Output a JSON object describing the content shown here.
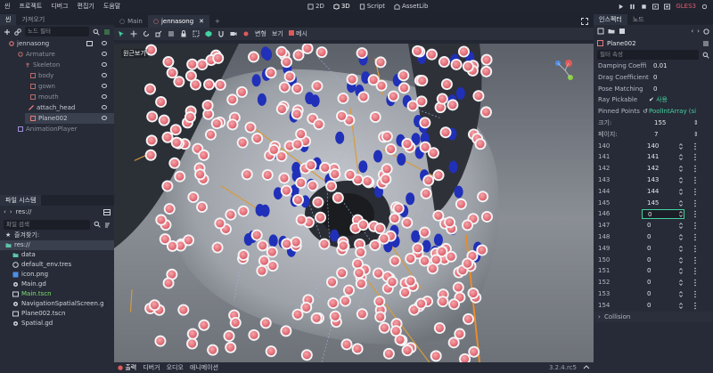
{
  "topbar": {
    "menus": [
      "씬",
      "프로젝트",
      "디버그",
      "편집기",
      "도움말"
    ],
    "workspaces": [
      "2D",
      "3D",
      "Script",
      "AssetLib"
    ],
    "renderer": "GLES3"
  },
  "scene_dock": {
    "tabs": [
      "씬",
      "가져오기"
    ],
    "filter_placeholder": "노드 필터",
    "nodes": [
      {
        "label": "jennasong",
        "indent": 0,
        "dim": false
      },
      {
        "label": "Armature",
        "indent": 1,
        "dim": true
      },
      {
        "label": "Skeleton",
        "indent": 2,
        "dim": true
      },
      {
        "label": "body",
        "indent": 3,
        "dim": true
      },
      {
        "label": "gown",
        "indent": 3,
        "dim": true
      },
      {
        "label": "mouth",
        "indent": 3,
        "dim": true
      },
      {
        "label": "attach_head",
        "indent": 2,
        "dim": false
      },
      {
        "label": "Plane002",
        "indent": 3,
        "dim": false
      },
      {
        "label": "AnimationPlayer",
        "indent": 1,
        "dim": true
      }
    ]
  },
  "filesystem": {
    "tab": "파일 시스템",
    "path": "res://",
    "search_placeholder": "파일 검색",
    "favorites_label": "즐겨찾기:",
    "root": "res://",
    "files": [
      {
        "name": "data",
        "type": "folder"
      },
      {
        "name": "default_env.tres",
        "type": "env"
      },
      {
        "name": "icon.png",
        "type": "image"
      },
      {
        "name": "Main.gd",
        "type": "script"
      },
      {
        "name": "Main.tscn",
        "type": "scene",
        "highlight": true
      },
      {
        "name": "NavigationSpatialScreen.g",
        "type": "script"
      },
      {
        "name": "Plane002.tscn",
        "type": "scene"
      },
      {
        "name": "Spatial.gd",
        "type": "script"
      }
    ]
  },
  "editor": {
    "scene_tabs": [
      "Main",
      "jennasong"
    ],
    "toolbar_labels": [
      "변형",
      "보기",
      "메시"
    ],
    "viewport_label": "원근보기",
    "bottom_tabs": [
      "출력",
      "디버거",
      "오디오",
      "애니메이션"
    ],
    "version": "3.2.4.rc5"
  },
  "inspector": {
    "tabs": [
      "인스펙터",
      "노드"
    ],
    "node_name": "Plane002",
    "filter_placeholder": "필터 속성",
    "properties": [
      {
        "key": "Damping Coeffi",
        "value": "0.01"
      },
      {
        "key": "Drag Coefficient",
        "value": "0"
      },
      {
        "key": "Pose Matching",
        "value": "0"
      },
      {
        "key": "Ray Pickable",
        "value": "사용"
      },
      {
        "key": "Pinned Points",
        "value": "PoolIntArray (si"
      }
    ],
    "size_label": "크기:",
    "size_value": "155",
    "page_label": "페이지:",
    "page_value": "7",
    "array_rows": [
      {
        "index": "140",
        "value": "140"
      },
      {
        "index": "141",
        "value": "141"
      },
      {
        "index": "142",
        "value": "142"
      },
      {
        "index": "143",
        "value": "143"
      },
      {
        "index": "144",
        "value": "144"
      },
      {
        "index": "145",
        "value": "145"
      },
      {
        "index": "146",
        "value": "0",
        "editing": true
      },
      {
        "index": "147",
        "value": "0"
      },
      {
        "index": "148",
        "value": "0"
      },
      {
        "index": "149",
        "value": "0"
      },
      {
        "index": "150",
        "value": "0"
      },
      {
        "index": "151",
        "value": "0"
      },
      {
        "index": "152",
        "value": "0"
      },
      {
        "index": "153",
        "value": "0"
      },
      {
        "index": "154",
        "value": "0"
      }
    ],
    "bottom_label": "Collision"
  },
  "colors": {
    "accent": "#45d3a1",
    "gizmo_red": "#e05a5a",
    "gizmo_green": "#8bd143",
    "gizmo_blue": "#4f8ee6",
    "pin_pink": "#e5707a",
    "pin_blue": "#2030b8"
  }
}
